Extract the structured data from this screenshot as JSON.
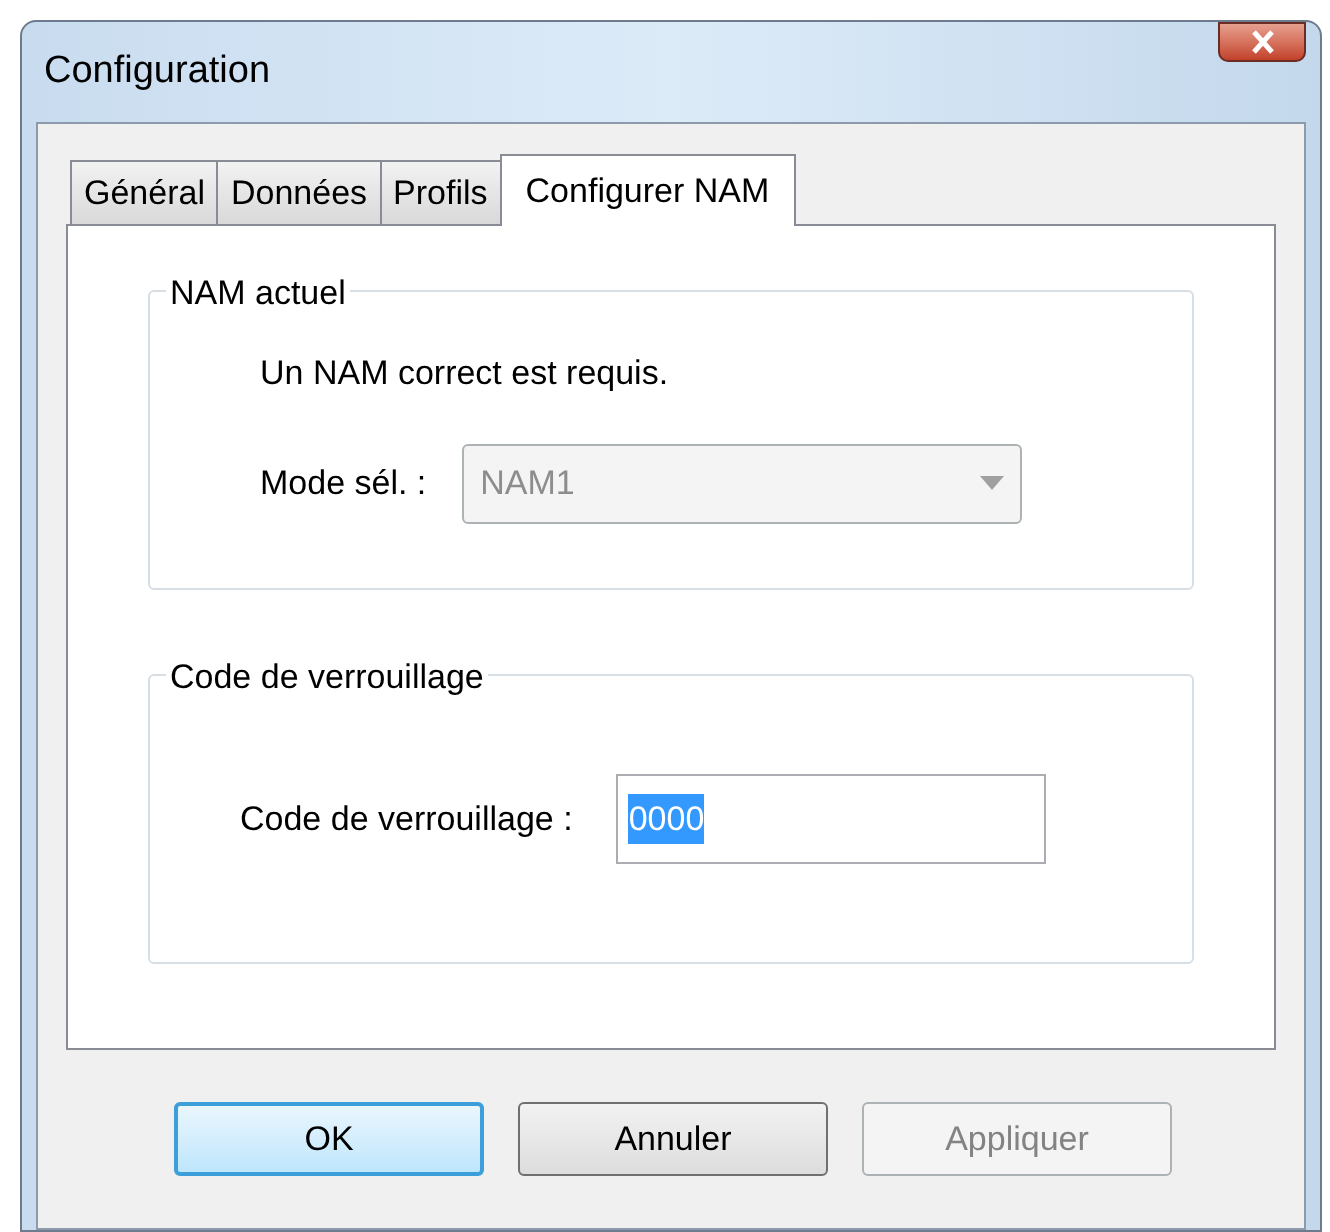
{
  "window": {
    "title": "Configuration"
  },
  "tabs": [
    {
      "label": "Général",
      "selected": false
    },
    {
      "label": "Données",
      "selected": false
    },
    {
      "label": "Profils",
      "selected": false
    },
    {
      "label": "Configurer NAM",
      "selected": true
    }
  ],
  "current_nam": {
    "title": "NAM actuel",
    "message": "Un NAM correct est requis.",
    "mode_label": "Mode sél. :",
    "mode_value": "NAM1",
    "disabled": true
  },
  "lock_code": {
    "title": "Code de verrouillage",
    "label": "Code de verrouillage :",
    "value": "0000",
    "value_selected": true
  },
  "buttons": [
    {
      "label": "OK",
      "default": true,
      "disabled": false
    },
    {
      "label": "Annuler",
      "default": false,
      "disabled": false
    },
    {
      "label": "Appliquer",
      "default": false,
      "disabled": true
    }
  ]
}
